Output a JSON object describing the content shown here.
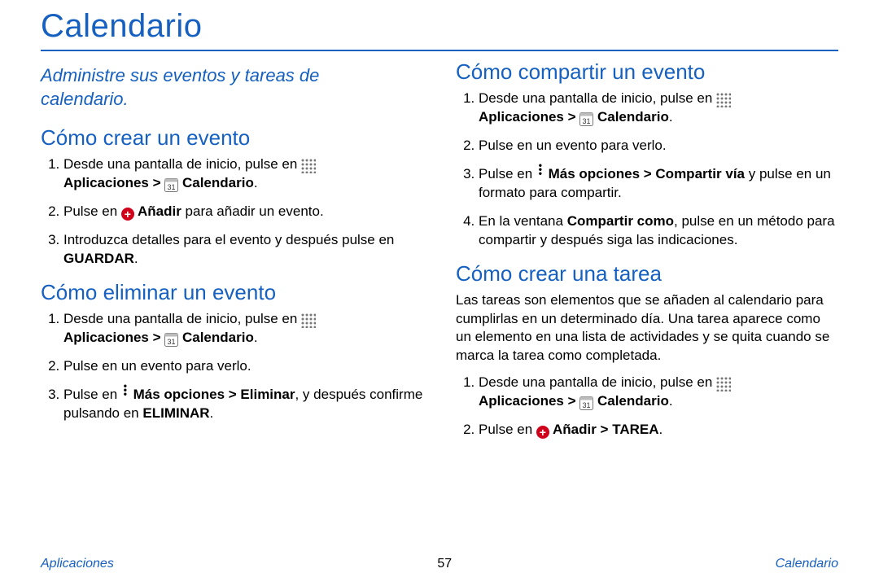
{
  "page_title": "Calendario",
  "subtitle": "Administre sus eventos y tareas de calendario.",
  "left": {
    "sec1": {
      "heading": "Cómo crear un evento",
      "step1_a": "Desde una pantalla de inicio, pulse en ",
      "step1_b": "Aplicaciones > ",
      "step1_c": " Calendario",
      "step1_d": ".",
      "step2_a": "Pulse en ",
      "step2_b": " Añadir",
      "step2_c": " para añadir un evento.",
      "step3": "Introduzca detalles para el evento y después pulse en ",
      "step3_b": "GUARDAR",
      "step3_c": "."
    },
    "sec2": {
      "heading": "Cómo eliminar un evento",
      "step1_a": "Desde una pantalla de inicio, pulse en ",
      "step1_b": "Aplicaciones > ",
      "step1_c": " Calendario",
      "step1_d": ".",
      "step2": "Pulse en un evento para verlo.",
      "step3_a": "Pulse en ",
      "step3_b": " Más opciones > Eliminar",
      "step3_c": ", y después confirme pulsando en ",
      "step3_d": "ELIMINAR",
      "step3_e": "."
    }
  },
  "right": {
    "sec1": {
      "heading": "Cómo compartir un evento",
      "step1_a": "Desde una pantalla de inicio, pulse en ",
      "step1_b": "Aplicaciones > ",
      "step1_c": " Calendario",
      "step1_d": ".",
      "step2": "Pulse en un evento para verlo.",
      "step3_a": "Pulse en ",
      "step3_b": " Más opciones > Compartir vía",
      "step3_c": " y pulse en un formato para compartir.",
      "step4_a": "En la ventana ",
      "step4_b": "Compartir como",
      "step4_c": ", pulse en un método para compartir y después siga las indicaciones."
    },
    "sec2": {
      "heading": "Cómo crear una tarea",
      "intro": "Las tareas son elementos que se añaden al calendario para cumplirlas en un determinado día. Una tarea aparece como un elemento en una lista de actividades y se quita cuando se marca la tarea como completada.",
      "step1_a": "Desde una pantalla de inicio, pulse en ",
      "step1_b": "Aplicaciones > ",
      "step1_c": " Calendario",
      "step1_d": ".",
      "step2_a": "Pulse en ",
      "step2_b": " Añadir > TAREA",
      "step2_c": "."
    }
  },
  "footer": {
    "left": "Aplicaciones",
    "page": "57",
    "right": "Calendario"
  }
}
